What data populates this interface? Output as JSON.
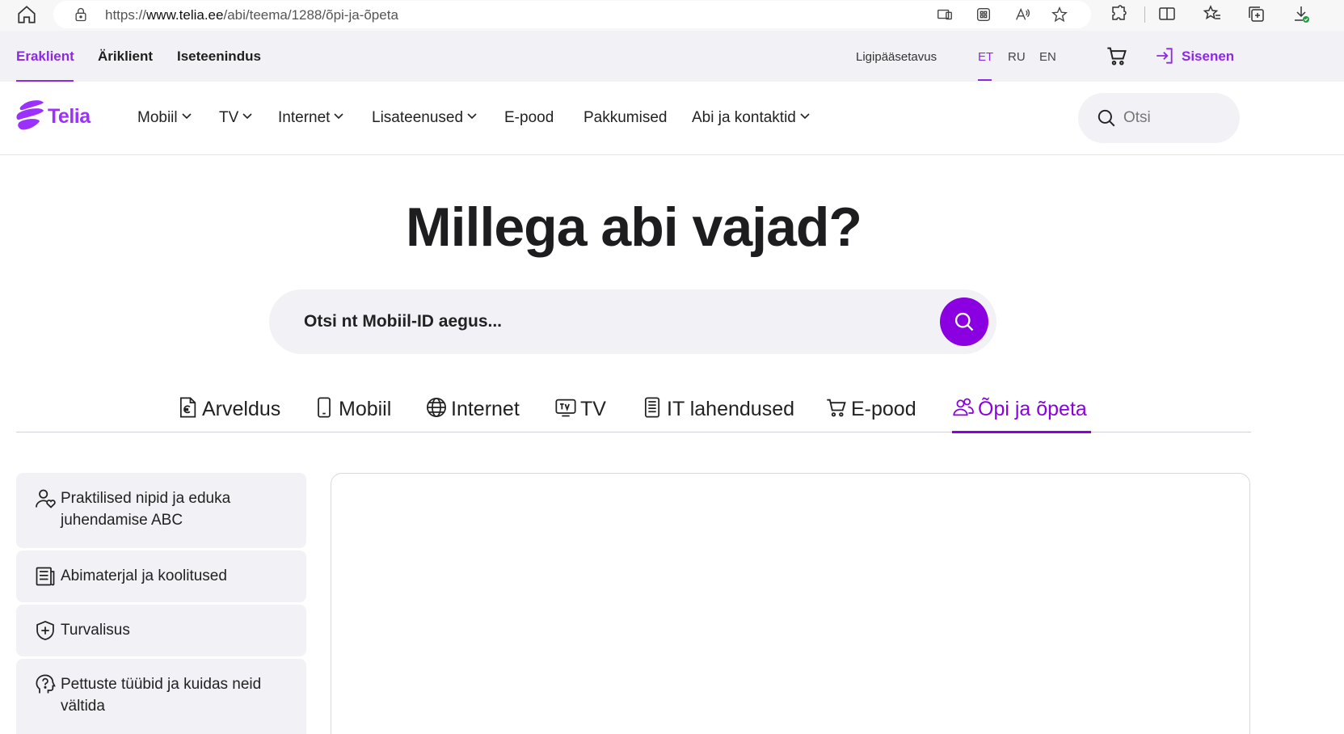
{
  "browser": {
    "url_prefix": "https://",
    "url_host": "www.telia.ee",
    "url_path": "/abi/teema/1288/õpi-ja-õpeta"
  },
  "utility_bar": {
    "segments": [
      {
        "label": "Eraklient",
        "active": true
      },
      {
        "label": "Äriklient",
        "active": false
      },
      {
        "label": "Iseteenindus",
        "active": false
      }
    ],
    "accessibility": "Ligipääsetavus",
    "languages": [
      {
        "label": "ET",
        "active": true
      },
      {
        "label": "RU",
        "active": false
      },
      {
        "label": "EN",
        "active": false
      }
    ],
    "login_label": "Sisenen"
  },
  "brand": {
    "name": "Telia",
    "color": "#9b30ff"
  },
  "main_nav": {
    "items": [
      {
        "label": "Mobiil",
        "dropdown": true
      },
      {
        "label": "TV",
        "dropdown": true
      },
      {
        "label": "Internet",
        "dropdown": true
      },
      {
        "label": "Lisateenused",
        "dropdown": true
      },
      {
        "label": "E-pood",
        "dropdown": false
      },
      {
        "label": "Pakkumised",
        "dropdown": false
      },
      {
        "label": "Abi ja kontaktid",
        "dropdown": true
      }
    ],
    "search_placeholder": "Otsi"
  },
  "hero": {
    "title": "Millega abi vajad?",
    "search_placeholder": "Otsi nt Mobiil-ID aegus..."
  },
  "category_tabs": [
    {
      "label": "Arveldus",
      "icon": "invoice-euro-icon",
      "active": false
    },
    {
      "label": "Mobiil",
      "icon": "phone-icon",
      "active": false
    },
    {
      "label": "Internet",
      "icon": "globe-icon",
      "active": false
    },
    {
      "label": "TV",
      "icon": "tv-icon",
      "active": false
    },
    {
      "label": "IT lahendused",
      "icon": "server-icon",
      "active": false
    },
    {
      "label": "E-pood",
      "icon": "cart-icon",
      "active": false
    },
    {
      "label": "Õpi ja õpeta",
      "icon": "people-icon",
      "active": true
    }
  ],
  "side_menu": [
    {
      "line1": "Praktilised nipid ja eduka",
      "line2": "juhendamise ABC",
      "icon": "person-heart-icon"
    },
    {
      "line1": "Abimaterjal ja koolitused",
      "line2": "",
      "icon": "document-icon"
    },
    {
      "line1": "Turvalisus",
      "line2": "",
      "icon": "shield-plus-icon"
    },
    {
      "line1": "Pettuste tüübid ja kuidas neid",
      "line2": "vältida",
      "icon": "head-question-icon"
    }
  ],
  "colors": {
    "accent": "#8a00e0",
    "utility_bg": "#f2f1f6",
    "text": "#222222"
  }
}
